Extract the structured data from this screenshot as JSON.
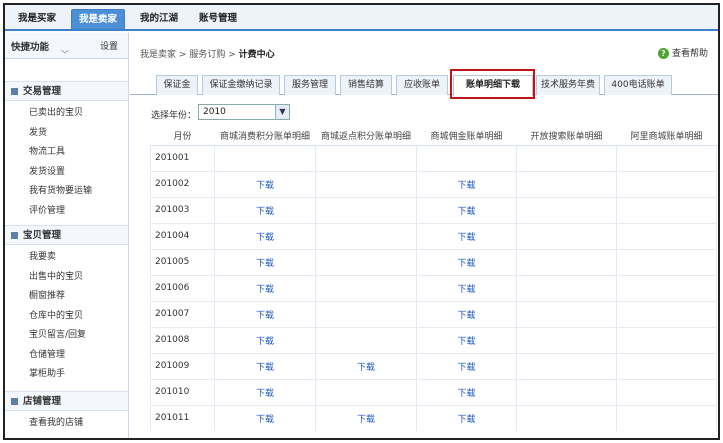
{
  "topnav": {
    "tabs": [
      "我是买家",
      "我是卖家",
      "我的江湖",
      "账号管理"
    ],
    "active": 1
  },
  "sidebar": {
    "quick_title": "快捷功能",
    "quick_settings": "设置",
    "sections": [
      {
        "title": "交易管理",
        "items": [
          "已卖出的宝贝",
          "发货",
          "物流工具",
          "发货设置",
          "我有货物要运输",
          "评价管理"
        ]
      },
      {
        "title": "宝贝管理",
        "items": [
          "我要卖",
          "出售中的宝贝",
          "橱窗推荐",
          "仓库中的宝贝",
          "宝贝留言/回复",
          "仓储管理",
          "掌柜助手"
        ]
      },
      {
        "title": "店铺管理",
        "items": [
          "查看我的店铺"
        ]
      }
    ]
  },
  "breadcrumb": {
    "items": [
      "我是卖家",
      "服务订购"
    ],
    "current": "计费中心",
    "sep": ">"
  },
  "help": {
    "label": "查看帮助"
  },
  "subtabs": {
    "items": [
      "保证金",
      "保证金缴纳记录",
      "服务管理",
      "销售结算",
      "应收账单",
      "账单明细下载",
      "技术服务年费",
      "400电话账单"
    ],
    "active": 5
  },
  "filter": {
    "label": "选择年份：",
    "value": "2010"
  },
  "table": {
    "headers": [
      "月份",
      "商城消费积分账单明细",
      "商城返点积分账单明细",
      "商城佣金账单明细",
      "开放搜索账单明细",
      "阿里商城账单明细"
    ],
    "rows": [
      [
        "201001",
        "",
        "",
        "",
        "",
        ""
      ],
      [
        "201002",
        "下载",
        "",
        "下载",
        "",
        ""
      ],
      [
        "201003",
        "下载",
        "",
        "下载",
        "",
        ""
      ],
      [
        "201004",
        "下载",
        "",
        "下载",
        "",
        ""
      ],
      [
        "201005",
        "下载",
        "",
        "下载",
        "",
        ""
      ],
      [
        "201006",
        "下载",
        "",
        "下载",
        "",
        ""
      ],
      [
        "201007",
        "下载",
        "",
        "下载",
        "",
        ""
      ],
      [
        "201008",
        "下载",
        "",
        "下载",
        "",
        ""
      ],
      [
        "201009",
        "下载",
        "下载",
        "下载",
        "",
        ""
      ],
      [
        "201010",
        "下载",
        "",
        "下载",
        "",
        ""
      ],
      [
        "201011",
        "下载",
        "下载",
        "下载",
        "",
        ""
      ]
    ]
  },
  "colors": {
    "accent": "#4d8fd6",
    "highlight": "#c0141a",
    "link": "#1a56c0"
  }
}
